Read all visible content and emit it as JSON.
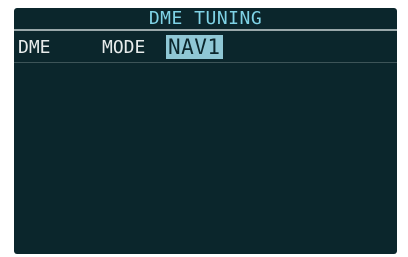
{
  "window": {
    "title": "DME TUNING"
  },
  "dme_row": {
    "label": "DME",
    "mode_label": "MODE",
    "mode_value": "NAV1"
  }
}
